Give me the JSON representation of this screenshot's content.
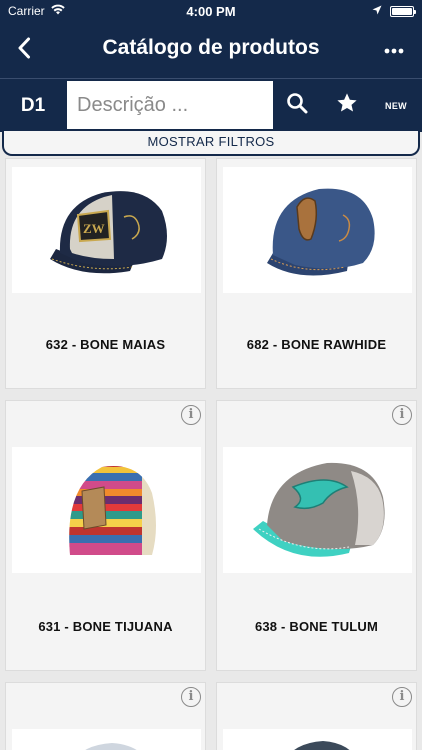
{
  "status_bar": {
    "carrier": "Carrier",
    "time": "4:00 PM"
  },
  "nav": {
    "title": "Catálogo de produtos"
  },
  "search": {
    "dept": "D1",
    "placeholder": "Descrição ...",
    "value": "",
    "new_label": "NEW"
  },
  "filters": {
    "label": "MOSTRAR FILTROS"
  },
  "products": [
    {
      "name": "632 - BONE MAIAS"
    },
    {
      "name": "682 - BONE RAWHIDE"
    },
    {
      "name": "631 - BONE TIJUANA"
    },
    {
      "name": "638 - BONE TULUM"
    }
  ],
  "colors": {
    "header": "#14294a",
    "card_bg": "#f4f4f4",
    "accent_teal": "#3fd1c2"
  },
  "icons": [
    "back-icon",
    "more-icon",
    "wifi-icon",
    "location-icon",
    "battery-icon",
    "search-icon",
    "star-icon",
    "info-icon"
  ]
}
